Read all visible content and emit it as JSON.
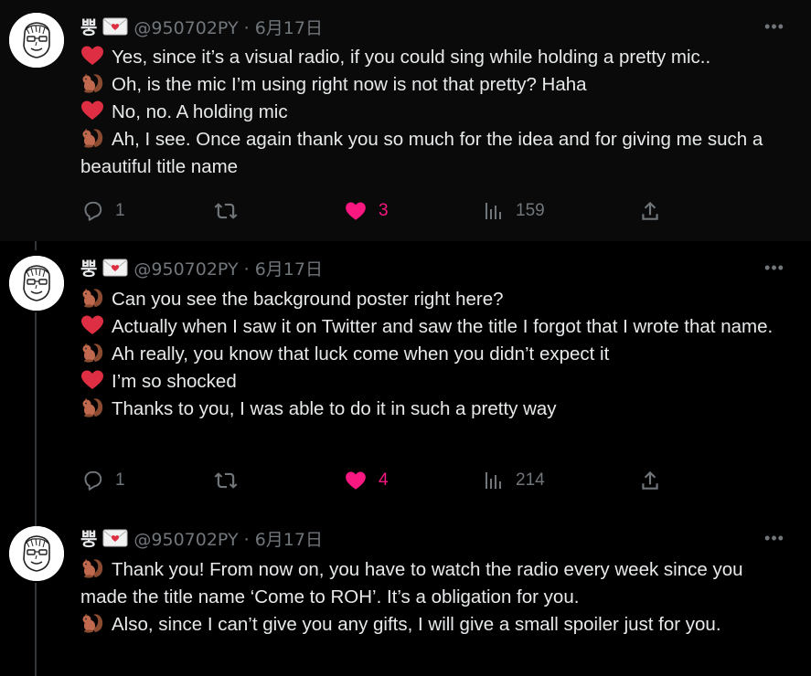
{
  "colors": {
    "background": "#000000",
    "text": "#e7e9ea",
    "muted": "#71767b",
    "like": "#f91880",
    "heart_emoji": "#dd2e44",
    "squirrel_emoji": "#c1694f"
  },
  "icons": {
    "reply": "speech-bubble-icon",
    "retweet": "retweet-arrows-icon",
    "like": "heart-icon",
    "views": "bar-chart-icon",
    "share": "share-upload-icon",
    "more": "ellipsis-icon",
    "name_badge": "love-letter-emoji",
    "speaker_a": "red-heart-emoji",
    "speaker_b": "chipmunk-emoji"
  },
  "tweets": [
    {
      "author": {
        "name": "뿡",
        "handle": "@950702PY",
        "date": "6月17日"
      },
      "lines": [
        {
          "speaker": "heart",
          "text": "Yes, since it’s a visual radio, if you could sing while holding a pretty mic.."
        },
        {
          "speaker": "squirrel",
          "text": "Oh, is the mic I’m using right now is not that pretty? Haha"
        },
        {
          "speaker": "heart",
          "text": "No, no. A holding mic"
        },
        {
          "speaker": "squirrel",
          "text": "Ah, I see. Once again thank you so much for the idea and for giving me such a beautiful title name"
        }
      ],
      "stats": {
        "replies": "1",
        "retweets": "",
        "likes": "3",
        "views": "159"
      }
    },
    {
      "author": {
        "name": "뿡",
        "handle": "@950702PY",
        "date": "6月17日"
      },
      "lines": [
        {
          "speaker": "squirrel",
          "text": "Can you see the background poster right here?"
        },
        {
          "speaker": "heart",
          "text": "Actually when I saw it on Twitter and saw the title I forgot that I wrote that name."
        },
        {
          "speaker": "squirrel",
          "text": "Ah really, you know that luck come when you didn’t expect it"
        },
        {
          "speaker": "heart",
          "text": "I’m so shocked"
        },
        {
          "speaker": "squirrel",
          "text": "Thanks to you, I was able to do it in such a pretty way"
        }
      ],
      "stats": {
        "replies": "1",
        "retweets": "",
        "likes": "4",
        "views": "214"
      }
    },
    {
      "author": {
        "name": "뿡",
        "handle": "@950702PY",
        "date": "6月17日"
      },
      "lines": [
        {
          "speaker": "squirrel",
          "text": "Thank you! From now on, you have to watch the radio every week since you made the title name ‘Come to ROH’. It’s a obligation for you."
        },
        {
          "speaker": "squirrel",
          "text": "Also, since I can’t give you any gifts, I will give a small spoiler just for you."
        }
      ],
      "stats": {
        "replies": "",
        "retweets": "",
        "likes": "",
        "views": ""
      }
    }
  ]
}
